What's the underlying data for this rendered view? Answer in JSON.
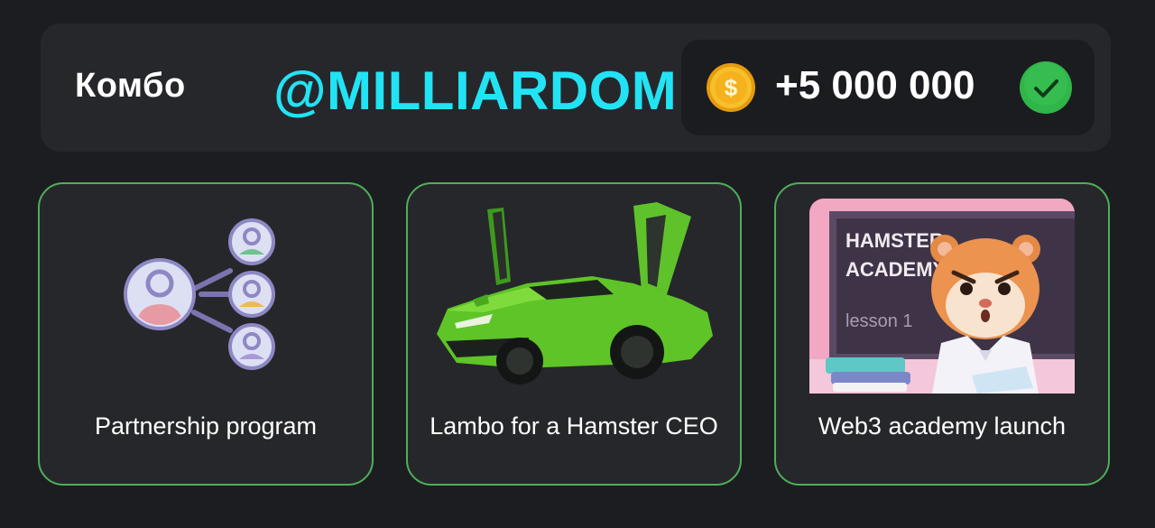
{
  "header": {
    "title": "Комбо",
    "watermark": "@MILLIARDOM",
    "reward": "+5 000 000",
    "coin_icon": "dollar-coin-icon",
    "status_icon": "checkmark-icon"
  },
  "cards": [
    {
      "label": "Partnership program",
      "icon": "partnership-network-icon"
    },
    {
      "label": "Lambo for a Hamster CEO",
      "icon": "green-lamborghini-image"
    },
    {
      "label": "Web3 academy launch",
      "icon": "hamster-academy-image",
      "board_text": [
        "HAMSTER",
        "ACADEMY",
        "lesson 1"
      ]
    }
  ],
  "colors": {
    "background": "#1c1d21",
    "panel": "#26272b",
    "card_border": "#4fae5a",
    "watermark": "#22e3f4",
    "check_green": "#2fb548",
    "coin_gold": "#f5b521"
  }
}
